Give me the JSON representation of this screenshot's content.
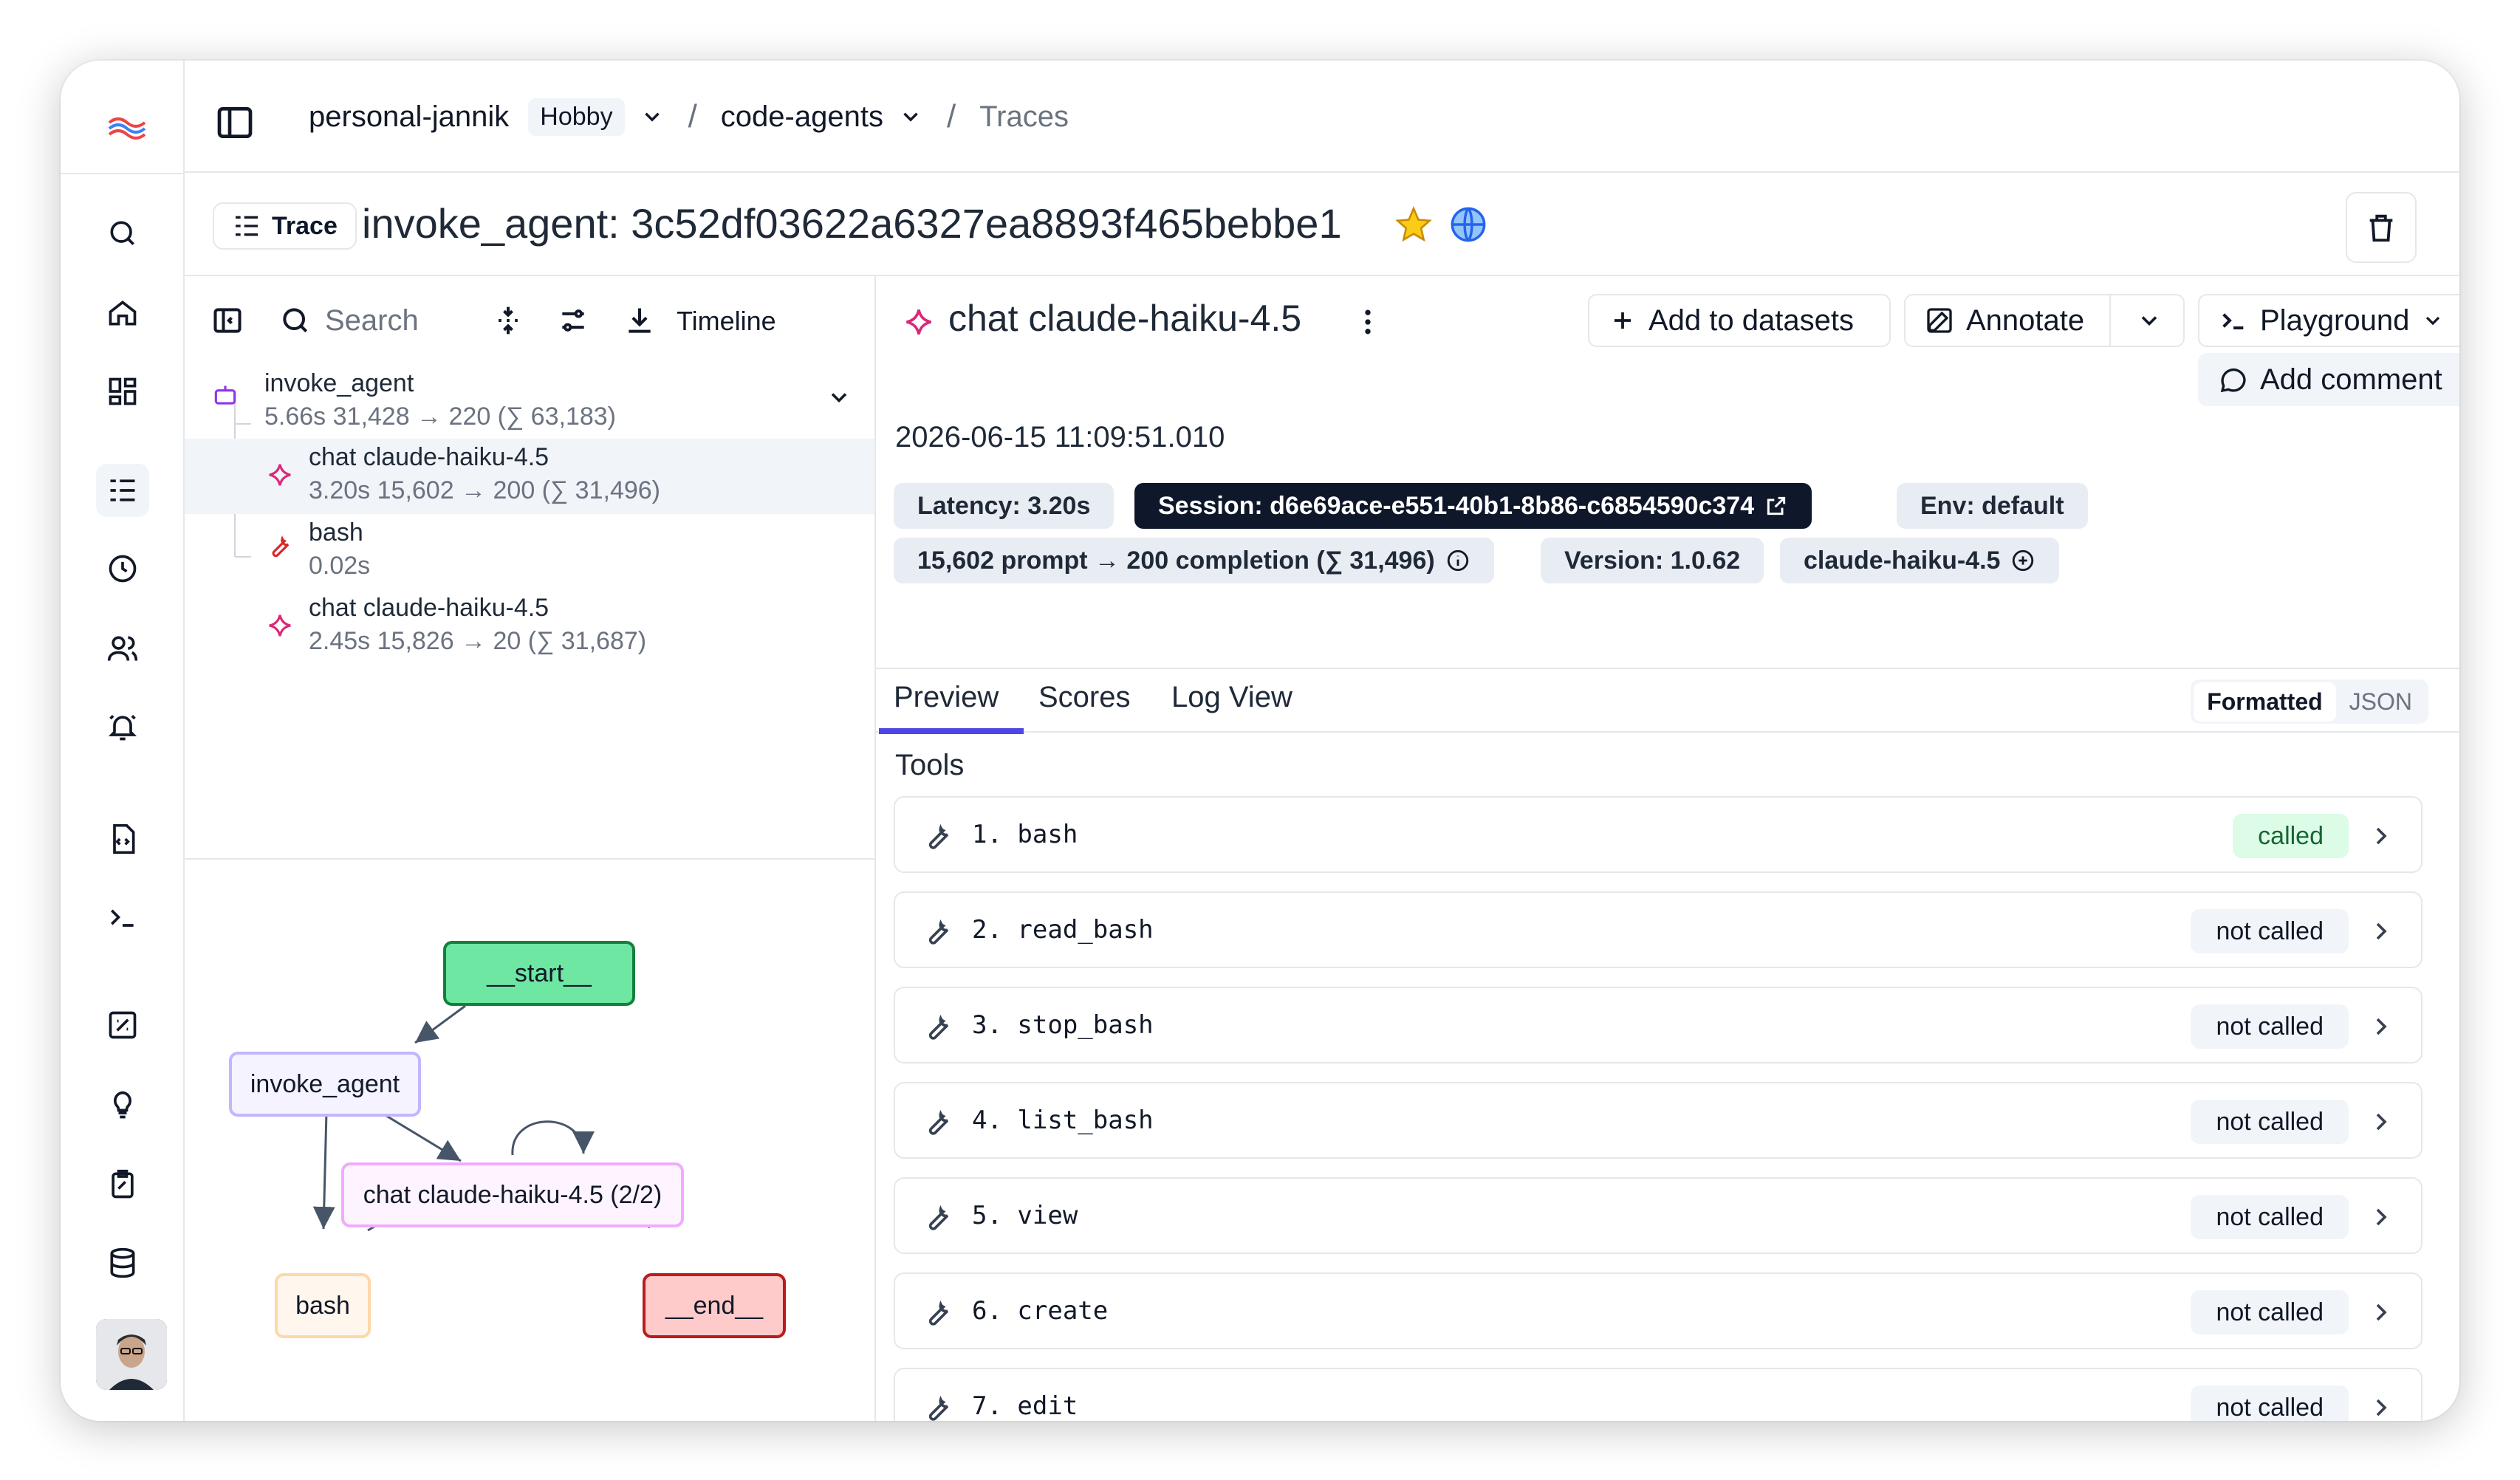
{
  "breadcrumbs": {
    "org": "personal-jannik",
    "plan": "Hobby",
    "project": "code-agents",
    "page": "Traces"
  },
  "trace": {
    "pill_label": "Trace",
    "title": "invoke_agent: 3c52df03622a6327ea8893f465bebbe1"
  },
  "tree_toolbar": {
    "search_placeholder": "Search",
    "timeline_label": "Timeline"
  },
  "tree": [
    {
      "name": "invoke_agent",
      "meta": "5.66s   31,428 → 220 (∑ 63,183)",
      "icon": "bot-icon"
    },
    {
      "name": "chat claude-haiku-4.5",
      "meta": "3.20s   15,602 → 200 (∑ 31,496)",
      "icon": "sparkle-icon"
    },
    {
      "name": "bash",
      "meta": "0.02s",
      "icon": "wrench-icon"
    },
    {
      "name": "chat claude-haiku-4.5",
      "meta": "2.45s   15,826 → 20 (∑ 31,687)",
      "icon": "sparkle-icon"
    }
  ],
  "graph": {
    "start": "__start__",
    "agent": "invoke_agent",
    "chat": "chat claude-haiku-4.5 (2/2)",
    "bash": "bash",
    "end": "__end__"
  },
  "detail": {
    "title": "chat claude-haiku-4.5",
    "add_datasets": "Add to datasets",
    "annotate": "Annotate",
    "playground": "Playground",
    "add_comment": "Add comment",
    "timestamp": "2026-06-15 11:09:51.010",
    "chips": {
      "latency": "Latency: 3.20s",
      "session": "Session: d6e69ace-e551-40b1-8b86-c6854590c374",
      "env": "Env: default",
      "tokens": "15,602 prompt → 200 completion (∑ 31,496)",
      "version": "Version: 1.0.62",
      "model": "claude-haiku-4.5"
    },
    "tabs": [
      "Preview",
      "Scores",
      "Log View"
    ],
    "format_on": "Formatted",
    "format_off": "JSON",
    "tools_label": "Tools",
    "tools": [
      {
        "name": "1. bash",
        "status": "called"
      },
      {
        "name": "2. read_bash",
        "status": "not called"
      },
      {
        "name": "3. stop_bash",
        "status": "not called"
      },
      {
        "name": "4. list_bash",
        "status": "not called"
      },
      {
        "name": "5. view",
        "status": "not called"
      },
      {
        "name": "6. create",
        "status": "not called"
      },
      {
        "name": "7. edit",
        "status": "not called"
      }
    ]
  },
  "colors": {
    "accent": "#4f46e5",
    "start_node": "#6ee7a3",
    "end_node": "#fecaca",
    "agent_border": "#c4b5fd",
    "chat_border": "#f0abfc",
    "bash_border": "#fed7aa"
  }
}
